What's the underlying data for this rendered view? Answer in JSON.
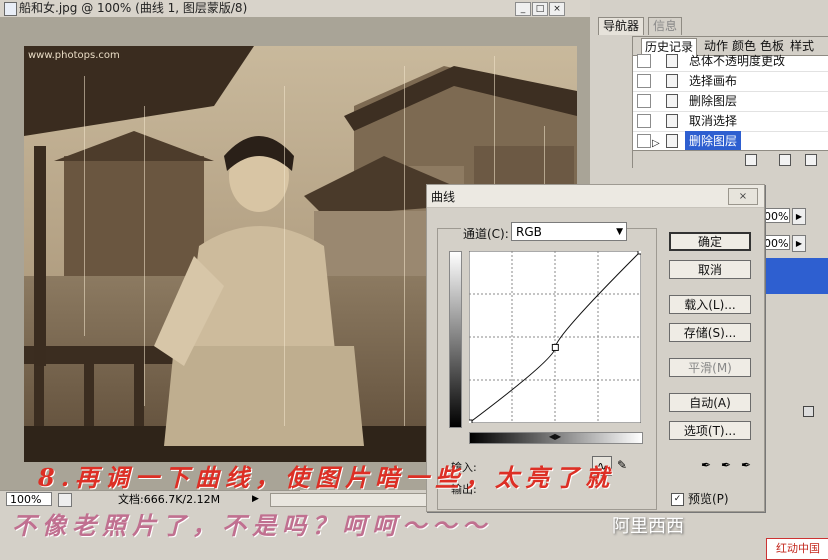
{
  "document": {
    "title": "船和女.jpg @ 100% (曲线 1, 图层蒙版/8)",
    "zoom": "100%",
    "doc_size": "文档:666.7K/2.12M",
    "watermark": "www.photops.com"
  },
  "panel_tabs": [
    "导航器",
    "信息"
  ],
  "history": {
    "tabs": [
      "历史记录",
      "动作",
      "颜色",
      "色板",
      "样式"
    ],
    "items": [
      {
        "label": "总体不透明度更改",
        "selected": false
      },
      {
        "label": "选择画布",
        "selected": false
      },
      {
        "label": "删除图层",
        "selected": false
      },
      {
        "label": "取消选择",
        "selected": false
      },
      {
        "label": "删除图层",
        "selected": true
      }
    ]
  },
  "layers": {
    "opacity": "100%",
    "fill": "100%"
  },
  "curves_dialog": {
    "title": "曲线",
    "channel_label": "通道(C):",
    "channel_value": "RGB",
    "input_label": "输入:",
    "output_label": "输出:",
    "buttons": {
      "ok": "确定",
      "cancel": "取消",
      "load": "载入(L)...",
      "save": "存储(S)...",
      "smooth": "平滑(M)",
      "auto": "自动(A)",
      "options": "选项(T)..."
    },
    "preview_label": "预览(P)",
    "preview_checked": true,
    "curve": {
      "points": [
        [
          0,
          0
        ],
        [
          128,
          128
        ],
        [
          255,
          255
        ]
      ],
      "midpoint": [
        128,
        112
      ]
    }
  },
  "captions": {
    "line1": "8.再调一下曲线，使图片暗一些，太亮了就",
    "line2": "不像老照片了，不是吗？呵呵～～～"
  },
  "branding": {
    "logo": "阿里西西",
    "stamp": "红动中国"
  },
  "colors": {
    "caption1": "#dd2f25",
    "caption2": "#c07090",
    "selection": "#2e5fd0",
    "sepia": "#8a7255"
  }
}
